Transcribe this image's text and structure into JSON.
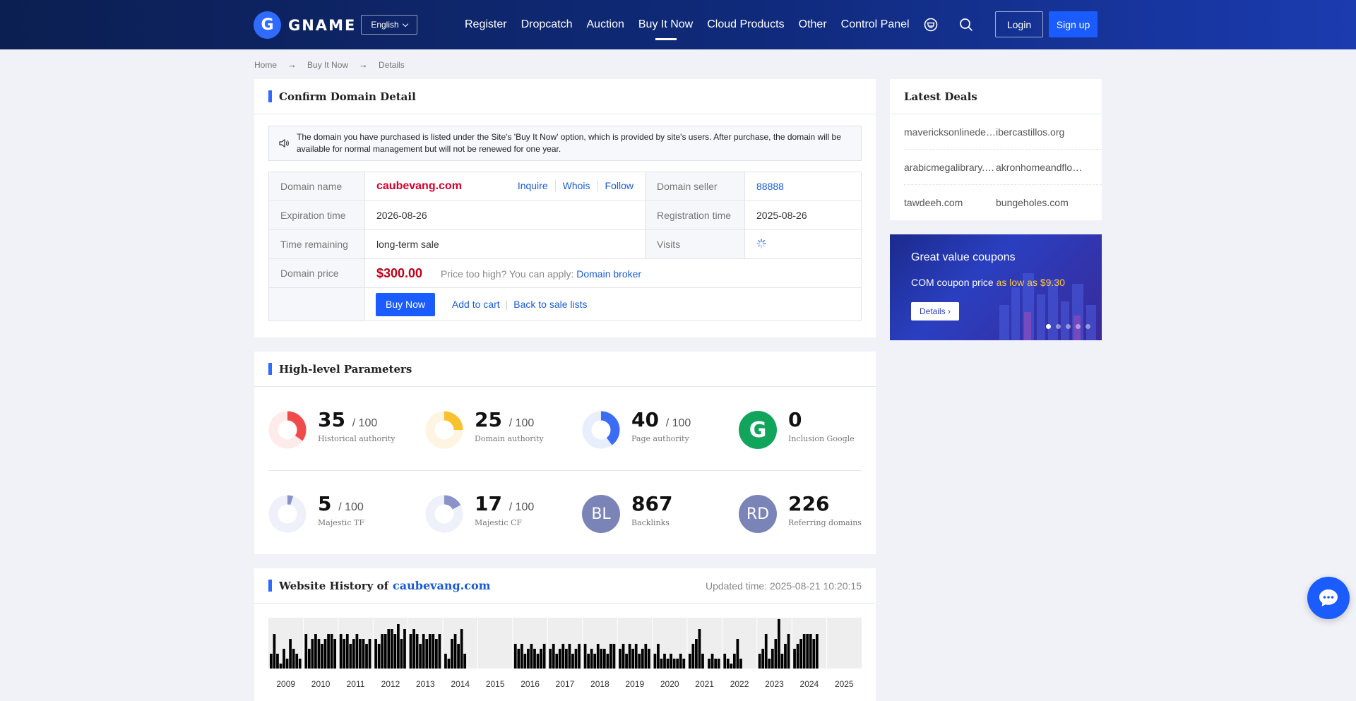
{
  "header": {
    "logo_text": "GNAME",
    "language": "English",
    "nav": [
      "Register",
      "Dropcatch",
      "Auction",
      "Buy It Now",
      "Cloud Products",
      "Other",
      "Control Panel"
    ],
    "login": "Login",
    "signup": "Sign up"
  },
  "breadcrumb": [
    "Home",
    "Buy It Now",
    "Details"
  ],
  "confirm": {
    "title": "Confirm Domain Detail",
    "notice": "The domain you have purchased is listed under the Site's 'Buy It Now' option, which is provided by site's users. After purchase, the domain will be available for normal management but will not be renewed for one year.",
    "domain_name_label": "Domain name",
    "domain_name": "caubevang.com",
    "inquire": "Inquire",
    "whois": "Whois",
    "follow": "Follow",
    "seller_label": "Domain seller",
    "seller": "88888",
    "expiration_label": "Expiration time",
    "expiration": "2026-08-26",
    "registration_label": "Registration time",
    "registration": "2025-08-26",
    "remaining_label": "Time remaining",
    "remaining": "long-term sale",
    "visits_label": "Visits",
    "price_label": "Domain price",
    "price": "$300.00",
    "price_hint": "Price too high? You can apply:",
    "broker": "Domain broker",
    "buy_now": "Buy Now",
    "add_cart": "Add to cart",
    "back": "Back to sale lists"
  },
  "params": {
    "title": "High-level Parameters",
    "denominator": "/ 100",
    "items": [
      {
        "value": "35",
        "label": "Historical authority",
        "pct": 35,
        "color": "#f04b4b",
        "track": "#fdeaea"
      },
      {
        "value": "25",
        "label": "Domain authority",
        "pct": 25,
        "color": "#f7c22e",
        "track": "#fdf5e1"
      },
      {
        "value": "40",
        "label": "Page authority",
        "pct": 40,
        "color": "#3b6cf4",
        "track": "#e8eefc"
      },
      {
        "value": "0",
        "label": "Inclusion Google",
        "icon": "G",
        "color": "#11a55b"
      },
      {
        "value": "5",
        "label": "Majestic TF",
        "pct": 5,
        "color": "#8a93c8",
        "track": "#eef1fa"
      },
      {
        "value": "17",
        "label": "Majestic CF",
        "pct": 17,
        "color": "#8a93c8",
        "track": "#eef1fa"
      },
      {
        "value": "867",
        "label": "Backlinks",
        "icon": "BL",
        "color": "#7b84b7"
      },
      {
        "value": "226",
        "label": "Referring domains",
        "icon": "RD",
        "color": "#7b84b7"
      }
    ]
  },
  "history": {
    "title": "Website History of",
    "domain": "caubevang.com",
    "updated": "Updated time: 2025-08-21 10:20:15",
    "years": [
      "2009",
      "2010",
      "2011",
      "2012",
      "2013",
      "2014",
      "2015",
      "2016",
      "2017",
      "2018",
      "2019",
      "2020",
      "2021",
      "2022",
      "2023",
      "2024",
      "2025"
    ]
  },
  "chart_data": {
    "type": "bar",
    "title": "Website History of caubevang.com",
    "xlabel": "",
    "ylabel": "",
    "categories": [
      "2009",
      "2010",
      "2011",
      "2012",
      "2013",
      "2014",
      "2015",
      "2016",
      "2017",
      "2018",
      "2019",
      "2020",
      "2021",
      "2022",
      "2023",
      "2024",
      "2025"
    ],
    "series": [
      {
        "values": [
          [
            0.3,
            0.7,
            0.3,
            0.1,
            0.4,
            0.2,
            0.6,
            0.4,
            0.3,
            0.2
          ],
          [
            0.7,
            0.4,
            0.6,
            0.7,
            0.6,
            0.5,
            0.6,
            0.7,
            0.7,
            0.6
          ],
          [
            0.7,
            0.6,
            0.7,
            0.5,
            0.6,
            0.7,
            0.6,
            0.6,
            0.5,
            0.6
          ],
          [
            0.6,
            0.5,
            0.7,
            0.7,
            0.8,
            0.8,
            0.7,
            0.9,
            0.6,
            0.8
          ],
          [
            0.7,
            0.8,
            0.7,
            0.5,
            0.7,
            0.6,
            0.7,
            0.7,
            0.6,
            0.7
          ],
          [
            0.3,
            0.2,
            0.6,
            0.7,
            0.5,
            0.8,
            0.3,
            0,
            0,
            0
          ],
          [
            0,
            0,
            0,
            0,
            0,
            0,
            0,
            0,
            0,
            0
          ],
          [
            0.5,
            0.4,
            0.5,
            0.3,
            0.4,
            0.5,
            0.4,
            0.3,
            0.4,
            0.5
          ],
          [
            0.4,
            0.5,
            0.3,
            0.4,
            0.5,
            0.4,
            0.5,
            0.3,
            0.4,
            0.5
          ],
          [
            0.5,
            0.3,
            0.4,
            0.3,
            0.5,
            0.4,
            0.4,
            0.3,
            0.5,
            0.5
          ],
          [
            0.4,
            0.5,
            0.3,
            0.5,
            0.4,
            0.5,
            0.3,
            0.4,
            0.5,
            0.4
          ],
          [
            0.3,
            0.5,
            0.2,
            0.3,
            0.2,
            0.3,
            0.2,
            0.2,
            0.3,
            0.2
          ],
          [
            0.3,
            0.5,
            0.6,
            0.8,
            0.3,
            0,
            0.2,
            0.3,
            0.2,
            0.2
          ],
          [
            0.3,
            0.2,
            0.1,
            0.3,
            0.6,
            0.2,
            0,
            0,
            0,
            0
          ],
          [
            0.3,
            0.4,
            0.7,
            0.2,
            0.4,
            0.6,
            1.0,
            0.3,
            0.5,
            0.7
          ],
          [
            0.4,
            0.5,
            0.6,
            0.7,
            0.7,
            0.7,
            0.6,
            0.7,
            0,
            0
          ],
          [
            0,
            0,
            0,
            0,
            0,
            0,
            0,
            0,
            0,
            0
          ]
        ]
      }
    ],
    "grid": false
  },
  "deals": {
    "title": "Latest Deals",
    "rows": [
      [
        "mavericksonlinedeals.com",
        "ibercastillos.org"
      ],
      [
        "arabicmegalibrary.com",
        "akronhomeandflower.com"
      ],
      [
        "tawdeeh.com",
        "bungeholes.com"
      ]
    ]
  },
  "banner": {
    "title": "Great value coupons",
    "sub_prefix": "COM coupon price",
    "sub_highlight": "as low as $9.30",
    "details": "Details"
  }
}
